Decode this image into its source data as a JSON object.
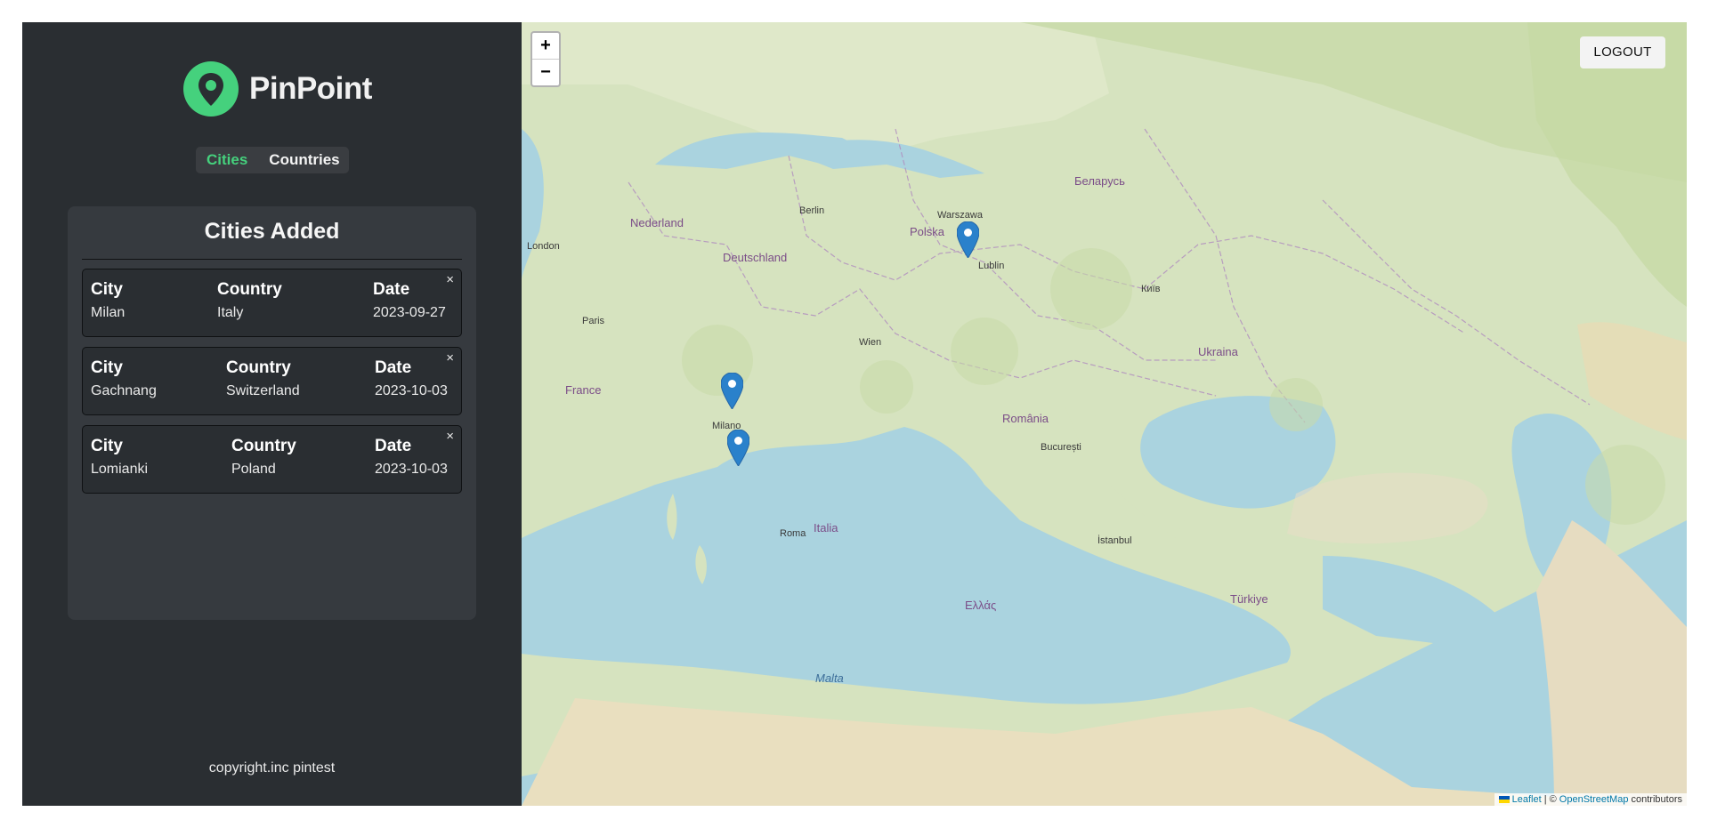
{
  "app": {
    "name": "PinPoint",
    "colors": {
      "accent": "#45d17d",
      "sidebar": "#2a2e32",
      "panel": "#363a3f",
      "marker": "#2a81cb"
    }
  },
  "nav": {
    "cities": "Cities",
    "countries": "Countries"
  },
  "panel": {
    "title": "Cities Added",
    "header_city": "City",
    "header_country": "Country",
    "header_date": "Date",
    "close_glyph": "×",
    "entries": [
      {
        "city": "Milan",
        "country": "Italy",
        "date": "2023-09-27"
      },
      {
        "city": "Gachnang",
        "country": "Switzerland",
        "date": "2023-10-03"
      },
      {
        "city": "Lomianki",
        "country": "Poland",
        "date": "2023-10-03"
      }
    ]
  },
  "footer": {
    "text": "copyright.inc pintest"
  },
  "map": {
    "zoom_in": "+",
    "zoom_out": "−",
    "logout": "LOGOUT",
    "attribution": {
      "leaflet": "Leaflet",
      "separator": "| ©",
      "osm": "OpenStreetMap",
      "contributors": "contributors"
    },
    "labels": {
      "nederland": "Nederland",
      "deutschland": "Deutschland",
      "polska": "Polska",
      "france": "France",
      "italia": "Italia",
      "espana": "Ukraina",
      "romania": "România",
      "turkiye": "Türkiye",
      "belarus": "Беларусь",
      "ellada": "Ελλάς",
      "malta": "Malta",
      "milano": "Milano",
      "warszawa": "Warszawa",
      "london": "London",
      "paris": "Paris",
      "wien": "Wien",
      "roma": "Roma",
      "berlin": "Berlin",
      "bucuresti": "București",
      "istanbul": "İstanbul",
      "lublin": "Lublin",
      "kyiv": "Київ"
    },
    "markers": [
      {
        "name": "Warszawa"
      },
      {
        "name": "Gachnang"
      },
      {
        "name": "Milan"
      }
    ]
  }
}
